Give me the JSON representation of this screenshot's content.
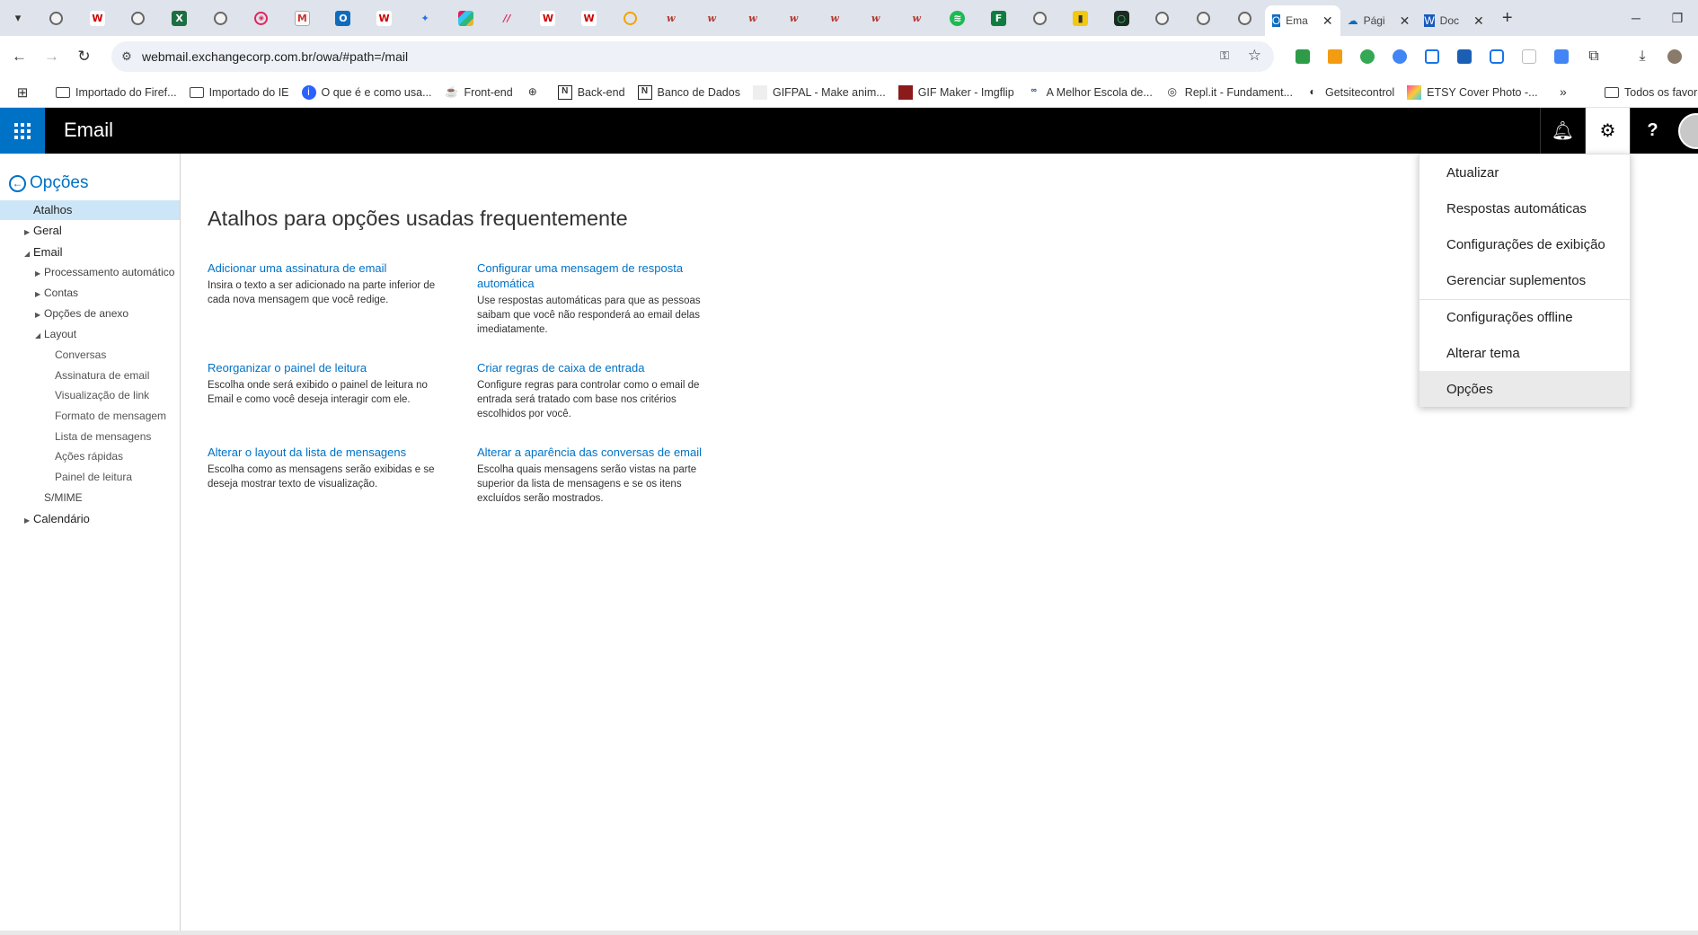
{
  "browser": {
    "tabs": [
      {
        "title": "Ema",
        "active": true
      },
      {
        "title": "Pági",
        "active": false
      },
      {
        "title": "Doc",
        "active": false
      }
    ],
    "url": "webmail.exchangecorp.com.br/owa/#path=/mail",
    "bookmarks": [
      "Importado do Firef...",
      "Importado do IE",
      "O que é e como usa...",
      "Front-end",
      "",
      "Back-end",
      "Banco de Dados",
      "GIFPAL - Make anim...",
      "GIF Maker - Imgflip",
      "A Melhor Escola de...",
      "Repl.it - Fundament...",
      "Getsitecontrol",
      "ETSY Cover Photo -..."
    ],
    "all_bookmarks": "Todos os favori"
  },
  "app": {
    "title": "Email"
  },
  "nav": {
    "back_label": "Opções",
    "items": [
      {
        "label": "Atalhos"
      },
      {
        "label": "Geral"
      },
      {
        "label": "Email"
      },
      {
        "label": "Processamento automático"
      },
      {
        "label": "Contas"
      },
      {
        "label": "Opções de anexo"
      },
      {
        "label": "Layout"
      },
      {
        "label": "Conversas"
      },
      {
        "label": "Assinatura de email"
      },
      {
        "label": "Visualização de link"
      },
      {
        "label": "Formato de mensagem"
      },
      {
        "label": "Lista de mensagens"
      },
      {
        "label": "Ações rápidas"
      },
      {
        "label": "Painel de leitura"
      },
      {
        "label": "S/MIME"
      },
      {
        "label": "Calendário"
      }
    ]
  },
  "main": {
    "heading": "Atalhos para opções usadas frequentemente",
    "shortcuts": [
      {
        "title": "Adicionar uma assinatura de email",
        "desc": "Insira o texto a ser adicionado na parte inferior de cada nova mensagem que você redige."
      },
      {
        "title": "Configurar uma mensagem de resposta automática",
        "desc": "Use respostas automáticas para que as pessoas saibam que você não responderá ao email delas imediatamente."
      },
      {
        "title": "Reorganizar o painel de leitura",
        "desc": "Escolha onde será exibido o painel de leitura no Email e como você deseja interagir com ele."
      },
      {
        "title": "Criar regras de caixa de entrada",
        "desc": "Configure regras para controlar como o email de entrada será tratado com base nos critérios escolhidos por você."
      },
      {
        "title": "Alterar o layout da lista de mensagens",
        "desc": "Escolha como as mensagens serão exibidas e se deseja mostrar texto de visualização."
      },
      {
        "title": "Alterar a aparência das conversas de email",
        "desc": "Escolha quais mensagens serão vistas na parte superior da lista de mensagens e se os itens excluídos serão mostrados."
      }
    ]
  },
  "settings_menu": {
    "items": [
      "Atualizar",
      "Respostas automáticas",
      "Configurações de exibição",
      "Gerenciar suplementos",
      "Configurações offline",
      "Alterar tema",
      "Opções"
    ]
  },
  "colors": {
    "accent": "#0072c6",
    "header_bg": "#000000",
    "selected_nav": "#cde6f7"
  }
}
